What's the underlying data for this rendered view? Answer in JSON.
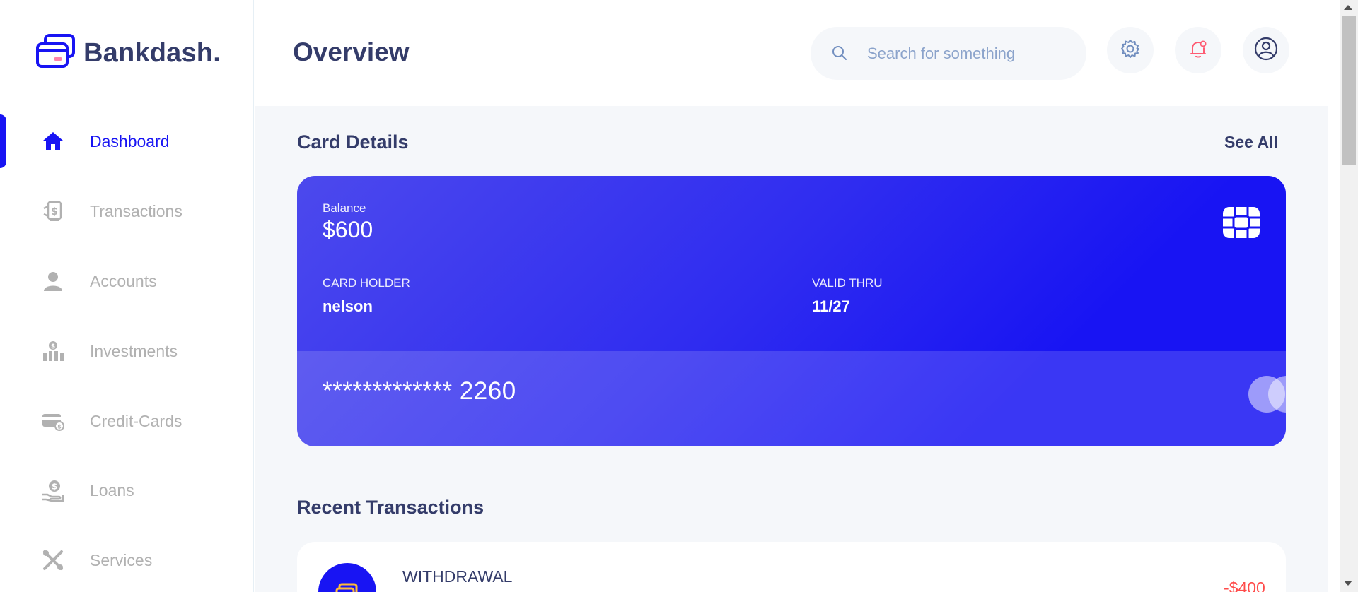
{
  "app": {
    "brand": "Bankdash."
  },
  "header": {
    "title": "Overview",
    "search_placeholder": "Search for something"
  },
  "sidebar": {
    "items": [
      {
        "label": "Dashboard",
        "icon": "home-icon",
        "active": true
      },
      {
        "label": "Transactions",
        "icon": "transactions-icon",
        "active": false
      },
      {
        "label": "Accounts",
        "icon": "user-icon",
        "active": false
      },
      {
        "label": "Investments",
        "icon": "investments-icon",
        "active": false
      },
      {
        "label": "Credit-Cards",
        "icon": "credit-card-icon",
        "active": false
      },
      {
        "label": "Loans",
        "icon": "loan-icon",
        "active": false
      },
      {
        "label": "Services",
        "icon": "tools-icon",
        "active": false
      }
    ]
  },
  "card_section": {
    "title": "Card Details",
    "see_all": "See All",
    "card": {
      "balance_label": "Balance",
      "balance_value": "$600",
      "holder_label": "CARD HOLDER",
      "holder_value": "nelson",
      "valid_label": "VALID THRU",
      "valid_value": "11/27",
      "number": "************* 2260"
    }
  },
  "transactions": {
    "title": "Recent Transactions",
    "items": [
      {
        "type": "WITHDRAWAL",
        "amount": "-$400"
      }
    ]
  },
  "colors": {
    "accent": "#1814f3",
    "text_primary": "#343c6a",
    "text_muted": "#b1b1b1",
    "background": "#f5f7fa",
    "negative": "#ff4b4a"
  }
}
